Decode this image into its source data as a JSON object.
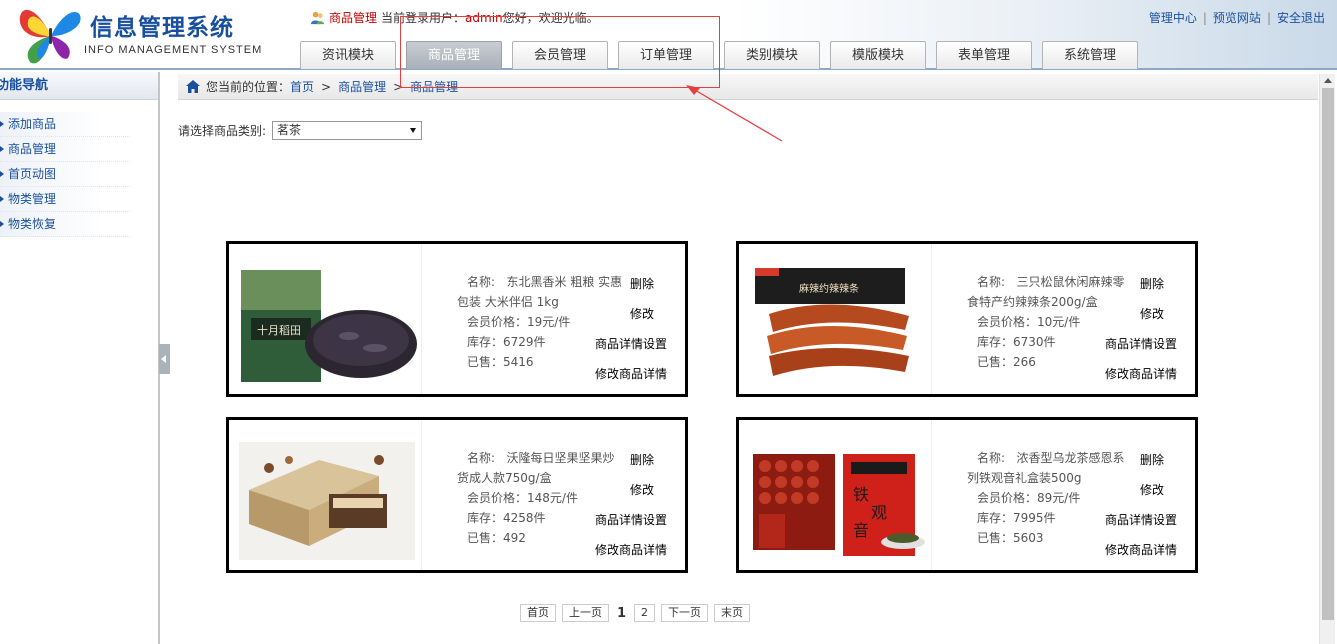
{
  "header": {
    "title": "信息管理系统",
    "subtitle": "INFO MANAGEMENT SYSTEM",
    "current_module": "商品管理",
    "login_prefix": "当前登录用户：",
    "username": "admin",
    "greeting": "您好，欢迎光临。",
    "links": [
      "管理中心",
      "预览网站",
      "安全退出"
    ],
    "tabs": [
      "资讯模块",
      "商品管理",
      "会员管理",
      "订单管理",
      "类别模块",
      "模版模块",
      "表单管理",
      "系统管理"
    ],
    "active_tab": "商品管理"
  },
  "sidebar": {
    "title": "功能导航",
    "items": [
      "添加商品",
      "商品管理",
      "首页动图",
      "物类管理",
      "物类恢复"
    ]
  },
  "breadcrumb": {
    "prefix": "您当前的位置：",
    "items": [
      "首页",
      "商品管理",
      "商品管理"
    ],
    "separator": ">"
  },
  "filter": {
    "label": "请选择商品类别:",
    "selected": "茗茶"
  },
  "products": [
    {
      "name_label": "名称:",
      "name": "东北黑香米 粗粮 实惠包装 大米伴侣 1kg",
      "price": "会员价格：19元/件",
      "stock": "库存：6729件",
      "sold": "已售：5416",
      "image_icon": "black-rice-package-icon"
    },
    {
      "name_label": "名称:",
      "name": "三只松鼠休闲麻辣零食特产约辣辣条200g/盒",
      "price": "会员价格：10元/件",
      "stock": "库存：6730件",
      "sold": "已售：266",
      "image_icon": "spicy-strips-icon"
    },
    {
      "name_label": "名称:",
      "name": "沃隆每日坚果坚果炒货成人款750g/盒",
      "price": "会员价格：148元/件",
      "stock": "库存：4258件",
      "sold": "已售：492",
      "image_icon": "nut-gift-box-icon"
    },
    {
      "name_label": "名称:",
      "name": "浓香型乌龙茶感恩系列铁观音礼盒装500g",
      "price": "会员价格：89元/件",
      "stock": "库存：7995件",
      "sold": "已售：5603",
      "image_icon": "oolong-tea-box-icon"
    }
  ],
  "product_actions": [
    "删除",
    "修改",
    "商品详情设置",
    "修改商品详情"
  ],
  "pager": {
    "first": "首页",
    "prev": "上一页",
    "current": "1",
    "page2": "2",
    "next": "下一页",
    "last": "末页"
  },
  "colors": {
    "brand_blue": "#1a4f9e",
    "alert_red": "#c00000",
    "annotation_red": "#e04040"
  }
}
